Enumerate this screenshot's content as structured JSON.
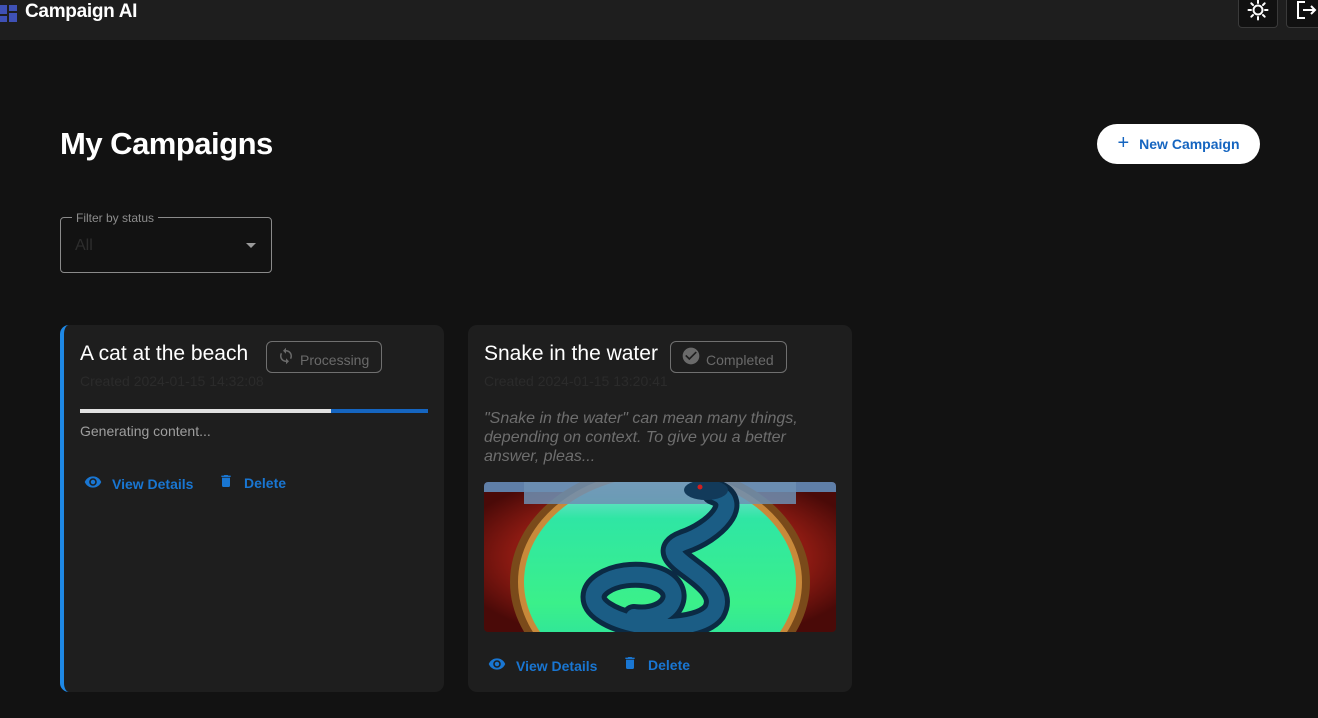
{
  "app": {
    "title": "Campaign AI",
    "icons": {
      "logo": "dashboard-icon",
      "theme": "sun-icon",
      "logout": "logout-icon"
    }
  },
  "page": {
    "title": "My Campaigns",
    "new_button_label": "New Campaign",
    "new_button_icon": "plus-icon"
  },
  "filter": {
    "label": "Filter by status",
    "value": "All"
  },
  "colors": {
    "accent": "#1976d2",
    "background": "#121212",
    "surface": "#1e1e1e",
    "progress_track": "#1565c0"
  },
  "campaigns": [
    {
      "title": "A cat at the beach",
      "status": "Processing",
      "status_icon": "sync-icon",
      "date": "Created 2024-01-15 14:32:08",
      "progress": 0.72,
      "status_text": "Generating content...",
      "actions": {
        "view": "View Details",
        "delete": "Delete"
      }
    },
    {
      "title": "Snake in the water",
      "status": "Completed",
      "status_icon": "check-circle-icon",
      "date": "Created 2024-01-15 13:20:41",
      "description": "\"Snake in the water\" can mean many things, depending on context. To give you a better answer, pleas...",
      "image_alt": "snake-in-water-image",
      "actions": {
        "view": "View Details",
        "delete": "Delete"
      }
    }
  ]
}
